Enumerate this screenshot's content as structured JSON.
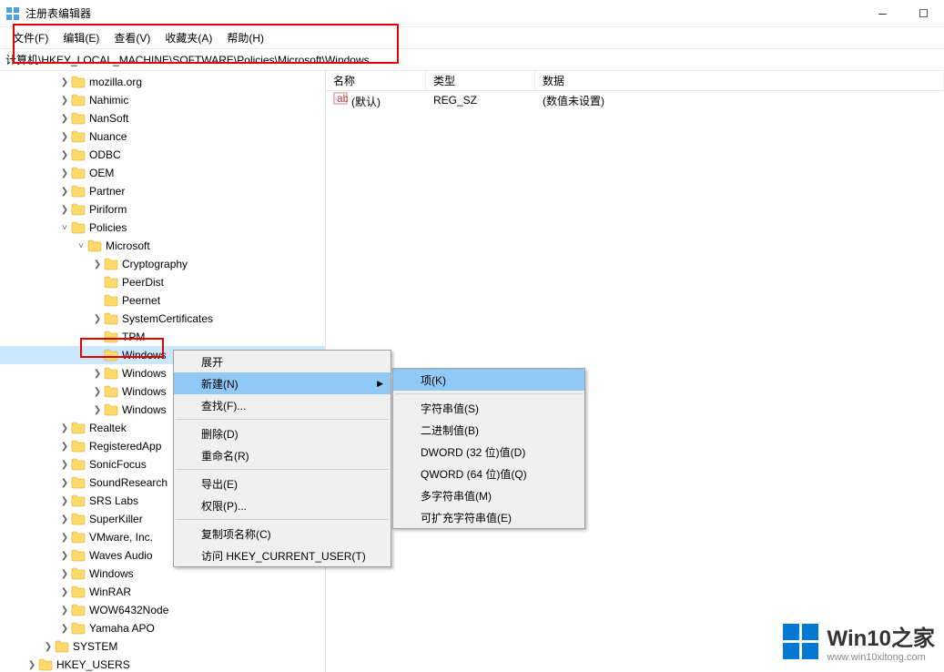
{
  "window": {
    "title": "注册表编辑器"
  },
  "menubar": {
    "file": "文件(F)",
    "edit": "编辑(E)",
    "view": "查看(V)",
    "fav": "收藏夹(A)",
    "help": "帮助(H)"
  },
  "address": {
    "path": "计算机\\HKEY_LOCAL_MACHINE\\SOFTWARE\\Policies\\Microsoft\\Windows"
  },
  "tree": [
    {
      "depth": 3,
      "exp": ">",
      "label": "mozilla.org"
    },
    {
      "depth": 3,
      "exp": ">",
      "label": "Nahimic"
    },
    {
      "depth": 3,
      "exp": ">",
      "label": "NanSoft"
    },
    {
      "depth": 3,
      "exp": ">",
      "label": "Nuance"
    },
    {
      "depth": 3,
      "exp": ">",
      "label": "ODBC"
    },
    {
      "depth": 3,
      "exp": ">",
      "label": "OEM"
    },
    {
      "depth": 3,
      "exp": ">",
      "label": "Partner"
    },
    {
      "depth": 3,
      "exp": ">",
      "label": "Piriform"
    },
    {
      "depth": 3,
      "exp": "v",
      "label": "Policies"
    },
    {
      "depth": 4,
      "exp": "v",
      "label": "Microsoft"
    },
    {
      "depth": 5,
      "exp": ">",
      "label": "Cryptography"
    },
    {
      "depth": 5,
      "exp": "",
      "label": "PeerDist"
    },
    {
      "depth": 5,
      "exp": "",
      "label": "Peernet"
    },
    {
      "depth": 5,
      "exp": ">",
      "label": "SystemCertificates"
    },
    {
      "depth": 5,
      "exp": "",
      "label": "TPM"
    },
    {
      "depth": 5,
      "exp": "",
      "label": "Windows",
      "selected": true
    },
    {
      "depth": 5,
      "exp": ">",
      "label": "Windows"
    },
    {
      "depth": 5,
      "exp": ">",
      "label": "Windows"
    },
    {
      "depth": 5,
      "exp": ">",
      "label": "Windows"
    },
    {
      "depth": 3,
      "exp": ">",
      "label": "Realtek"
    },
    {
      "depth": 3,
      "exp": ">",
      "label": "RegisteredApp"
    },
    {
      "depth": 3,
      "exp": ">",
      "label": "SonicFocus"
    },
    {
      "depth": 3,
      "exp": ">",
      "label": "SoundResearch"
    },
    {
      "depth": 3,
      "exp": ">",
      "label": "SRS Labs"
    },
    {
      "depth": 3,
      "exp": ">",
      "label": "SuperKiller"
    },
    {
      "depth": 3,
      "exp": ">",
      "label": "VMware, Inc."
    },
    {
      "depth": 3,
      "exp": ">",
      "label": "Waves Audio"
    },
    {
      "depth": 3,
      "exp": ">",
      "label": "Windows"
    },
    {
      "depth": 3,
      "exp": ">",
      "label": "WinRAR"
    },
    {
      "depth": 3,
      "exp": ">",
      "label": "WOW6432Node"
    },
    {
      "depth": 3,
      "exp": ">",
      "label": "Yamaha APO"
    },
    {
      "depth": 2,
      "exp": ">",
      "label": "SYSTEM"
    },
    {
      "depth": 1,
      "exp": ">",
      "label": "HKEY_USERS"
    }
  ],
  "list": {
    "columns": {
      "name": "名称",
      "type": "类型",
      "data": "数据"
    },
    "rows": [
      {
        "name": "(默认)",
        "type": "REG_SZ",
        "data": "(数值未设置)"
      }
    ]
  },
  "context_menu": {
    "expand": "展开",
    "new": "新建(N)",
    "find": "查找(F)...",
    "delete": "删除(D)",
    "rename": "重命名(R)",
    "export": "导出(E)",
    "perm": "权限(P)...",
    "copykey": "复制项名称(C)",
    "gotohkcu": "访问 HKEY_CURRENT_USER(T)"
  },
  "submenu": {
    "key": "项(K)",
    "string": "字符串值(S)",
    "binary": "二进制值(B)",
    "dword": "DWORD (32 位)值(D)",
    "qword": "QWORD (64 位)值(Q)",
    "multi": "多字符串值(M)",
    "expand": "可扩充字符串值(E)"
  },
  "watermark": {
    "title": "Win10之家",
    "url": "www.win10xitong.com"
  }
}
